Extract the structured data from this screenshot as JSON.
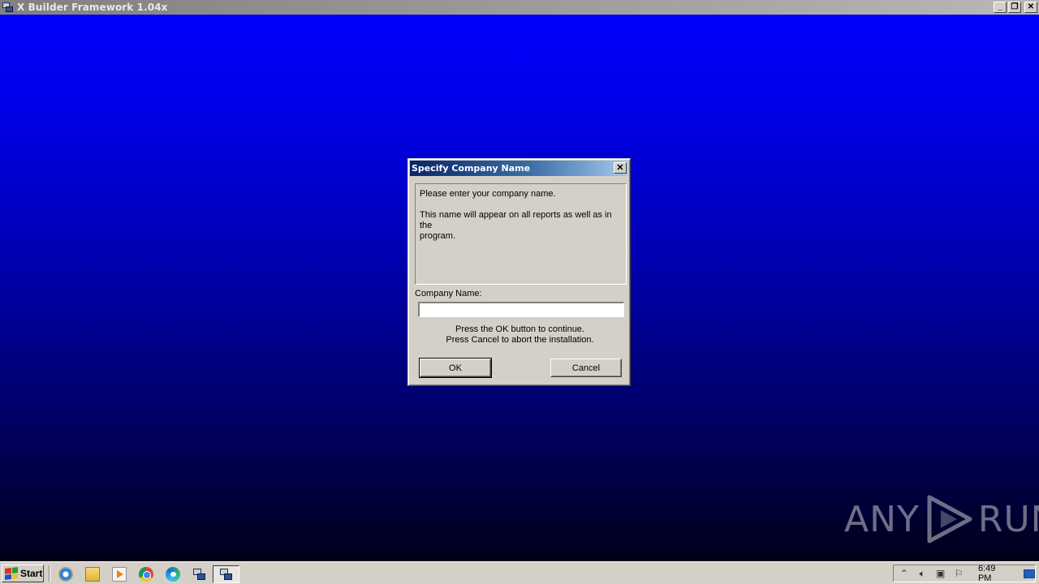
{
  "window": {
    "title": "X Builder Framework 1.04x",
    "buttons": {
      "minimize": "_",
      "restore": "❐",
      "close": "✕"
    }
  },
  "dialog": {
    "title": "Specify Company Name",
    "close_glyph": "✕",
    "info_line1": "Please enter your company name.",
    "info_line2": "This name will appear on all reports as well as in the",
    "info_line3": "program.",
    "company_label": "Company Name:",
    "company_value": "",
    "hint1": "Press the OK button to continue.",
    "hint2": "Press Cancel to abort the installation.",
    "ok_label": "OK",
    "cancel_label": "Cancel"
  },
  "watermark": {
    "left": "ANY",
    "right": "RUN"
  },
  "taskbar": {
    "start_label": "Start",
    "quick_launch": [
      "internet-explorer-icon",
      "folder-icon",
      "media-player-icon",
      "chrome-icon",
      "edge-icon",
      "installer-icon",
      "x-builder-icon"
    ],
    "tray": {
      "icons": [
        "chevron-up-icon",
        "speaker-icon",
        "network-icon",
        "flag-icon"
      ],
      "time": "6:49 PM"
    }
  },
  "colors": {
    "desktop_top": "#0000ff",
    "desktop_bottom": "#00001a",
    "dialog_face": "#d4d0c8",
    "dialog_title_start": "#0a246a",
    "dialog_title_end": "#a6caf0"
  }
}
